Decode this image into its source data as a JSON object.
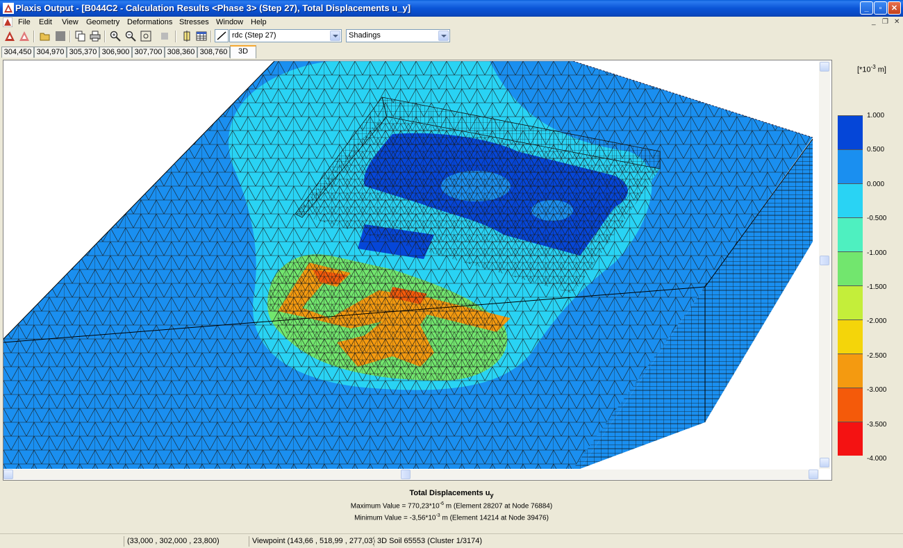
{
  "window": {
    "title": "Plaxis Output - [B044C2 - Calculation Results <Phase 3> (Step 27), Total Displacements u_y]"
  },
  "menu": {
    "items": [
      "File",
      "Edit",
      "View",
      "Geometry",
      "Deformations",
      "Stresses",
      "Window",
      "Help"
    ]
  },
  "toolbar": {
    "step_select": "rdc (Step 27)",
    "plot_type_select": "Shadings"
  },
  "tabs": {
    "items": [
      "304,450",
      "304,970",
      "305,370",
      "306,900",
      "307,700",
      "308,360",
      "308,760",
      "3D"
    ],
    "active": "3D"
  },
  "legend": {
    "unit_prefix": "[*10",
    "unit_exp": "-3",
    "unit_suffix": "m]",
    "colors": [
      "#0546d8",
      "#1a8ff0",
      "#29d3f4",
      "#4ef0c0",
      "#72e66e",
      "#c4ee3a",
      "#f4d50a",
      "#f49a10",
      "#f45a0a",
      "#f41212"
    ],
    "labels": [
      "1.000",
      "0.500",
      "0.000",
      "-0.500",
      "-1.000",
      "-1.500",
      "-2.000",
      "-2.500",
      "-3.000",
      "-3.500",
      "-4.000"
    ]
  },
  "results": {
    "title": "Total Displacements u",
    "title_sub": "y",
    "max_prefix": "Maximum Value = 770,23*10",
    "max_exp": "-6",
    "max_suffix": " m (Element 28207 at Node 76884)",
    "min_prefix": "Minimum Value = -3,56*10",
    "min_exp": "-3",
    "min_suffix": " m (Element 14214 at Node 39476)"
  },
  "status": {
    "coordinates": "(33,000 , 302,000 , 23,800)",
    "viewpoint": "Viewpoint (143,66 , 518,99 , 277,03)",
    "cluster": "3D Soil 65553 (Cluster 1/3174)"
  }
}
